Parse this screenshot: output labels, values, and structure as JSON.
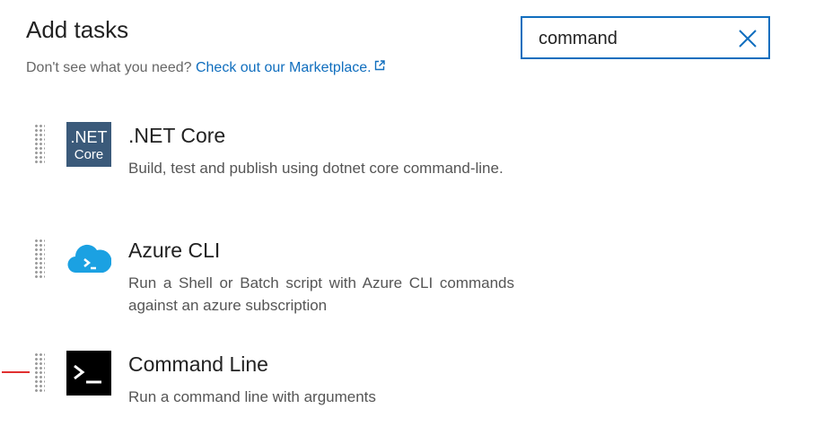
{
  "header": {
    "title": "Add tasks",
    "subtitle_prefix": "Don't see what you need? ",
    "marketplace_link": "Check out our Marketplace.",
    "external_icon": "external-link-icon"
  },
  "search": {
    "value": "command",
    "clear_icon": "close-icon",
    "border_color": "#106ebe"
  },
  "tasks": [
    {
      "name": ".NET Core",
      "description": "Build, test and publish using dotnet core command-line.",
      "icon": "dotnet-core-icon",
      "icon_text_line1": ".NET",
      "icon_text_line2": "Core",
      "icon_bg": "#3b5a7a"
    },
    {
      "name": "Azure CLI",
      "description": "Run a Shell or Batch script with Azure CLI commands against an azure subscription",
      "icon": "azure-cli-cloud-icon",
      "icon_color": "#1ba1e2"
    },
    {
      "name": "Command Line",
      "description": "Run a command line with arguments",
      "icon": "terminal-icon",
      "icon_bg": "#000000"
    }
  ],
  "colors": {
    "link": "#106ebe",
    "drag_marker": "#e03030"
  }
}
